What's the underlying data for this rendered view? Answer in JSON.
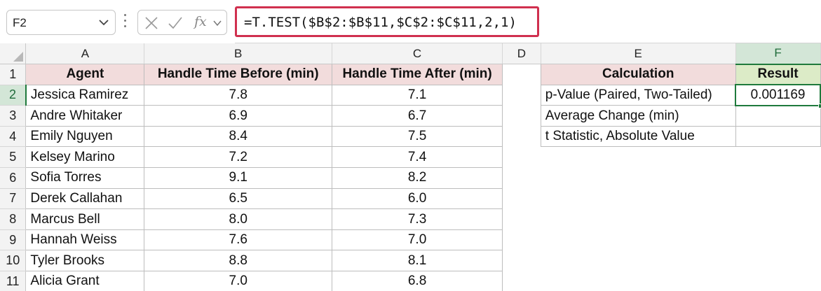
{
  "formula_bar": {
    "name_box": "F2",
    "fx_label": "fx",
    "formula": "=T.TEST($B$2:$B$11,$C$2:$C$11,2,1)"
  },
  "columns": [
    "A",
    "B",
    "C",
    "D",
    "E",
    "F"
  ],
  "rows": [
    "1",
    "2",
    "3",
    "4",
    "5",
    "6",
    "7",
    "8",
    "9",
    "10",
    "11"
  ],
  "main_table": {
    "headers": [
      "Agent",
      "Handle Time Before (min)",
      "Handle Time After (min)"
    ],
    "records": [
      [
        "Jessica Ramirez",
        "7.8",
        "7.1"
      ],
      [
        "Andre Whitaker",
        "6.9",
        "6.7"
      ],
      [
        "Emily Nguyen",
        "8.4",
        "7.5"
      ],
      [
        "Kelsey Marino",
        "7.2",
        "7.4"
      ],
      [
        "Sofia Torres",
        "9.1",
        "8.2"
      ],
      [
        "Derek Callahan",
        "6.5",
        "6.0"
      ],
      [
        "Marcus Bell",
        "8.0",
        "7.3"
      ],
      [
        "Hannah Weiss",
        "7.6",
        "7.0"
      ],
      [
        "Tyler Brooks",
        "8.8",
        "8.1"
      ],
      [
        "Alicia Grant",
        "7.0",
        "6.8"
      ]
    ]
  },
  "calc_table": {
    "headers": [
      "Calculation",
      "Result"
    ],
    "records": [
      [
        "p-Value (Paired, Two-Tailed)",
        "0.001169"
      ],
      [
        "Average Change (min)",
        ""
      ],
      [
        "t Statistic, Absolute Value",
        ""
      ]
    ]
  },
  "colors": {
    "header_fill": "#f2dcdc",
    "result_header_fill": "#dcebc7",
    "selection": "#1f7a3c",
    "formula_highlight": "#d0304f"
  }
}
